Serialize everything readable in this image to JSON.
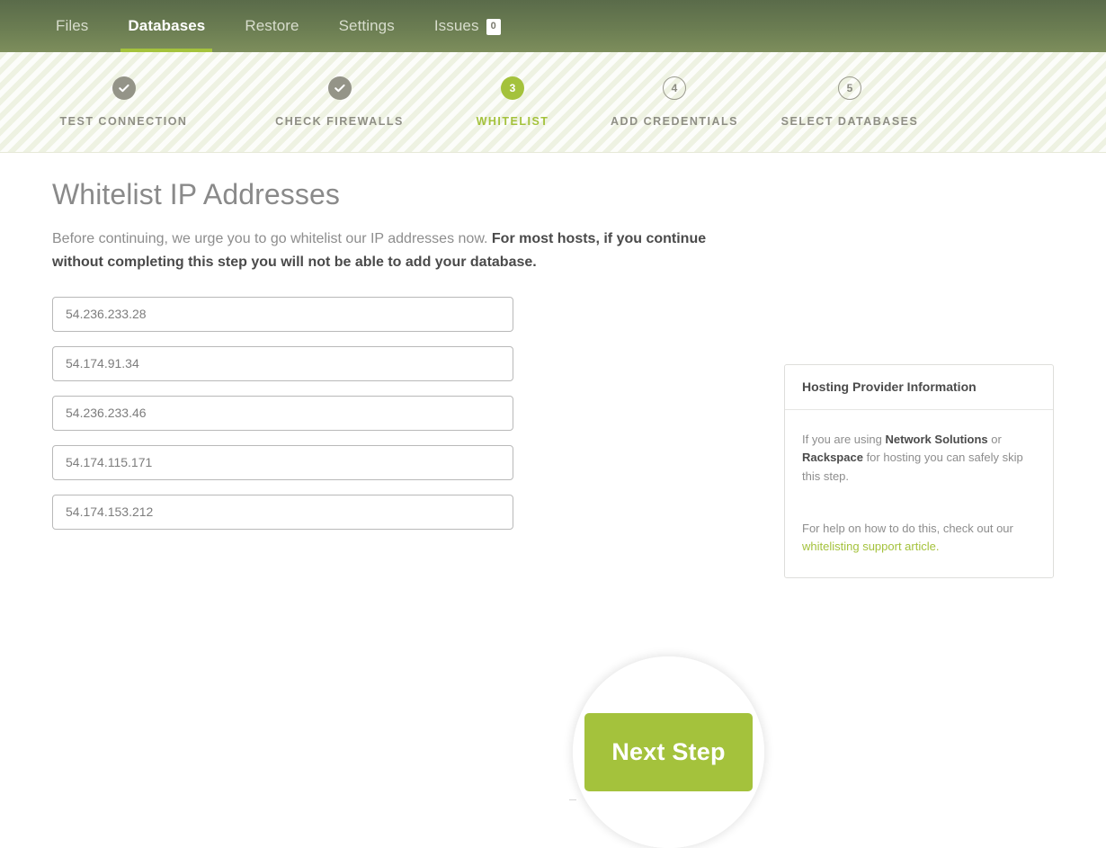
{
  "nav": {
    "items": [
      {
        "label": "Files",
        "active": false
      },
      {
        "label": "Databases",
        "active": true
      },
      {
        "label": "Restore",
        "active": false
      },
      {
        "label": "Settings",
        "active": false
      },
      {
        "label": "Issues",
        "active": false,
        "badge": "0"
      }
    ],
    "accent_color": "#a4c23c",
    "bar_color": "#6b7d52"
  },
  "stepper": {
    "steps": [
      {
        "number": "1",
        "label": "TEST CONNECTION",
        "state": "done",
        "icon": "check-icon"
      },
      {
        "number": "2",
        "label": "CHECK FIREWALLS",
        "state": "done",
        "icon": "check-icon"
      },
      {
        "number": "3",
        "label": "WHITELIST",
        "state": "active"
      },
      {
        "number": "4",
        "label": "ADD CREDENTIALS",
        "state": "pending"
      },
      {
        "number": "5",
        "label": "SELECT DATABASES",
        "state": "pending"
      }
    ],
    "done_color": "#949488",
    "active_color": "#a4c23c",
    "pending_color": "#9a9a8e"
  },
  "main": {
    "title": "Whitelist IP Addresses",
    "lede_normal": "Before continuing, we urge you to go whitelist our IP addresses now. ",
    "lede_bold": "For most hosts, if you continue without completing this step you will not be able to add your database.",
    "ip_addresses": [
      "54.236.233.28",
      "54.174.91.34",
      "54.236.233.46",
      "54.174.115.171",
      "54.174.153.212"
    ],
    "next_button_label": "Next Step"
  },
  "side_panel": {
    "title": "Hosting Provider Information",
    "para1_a": "If you are using ",
    "para1_b1": "Network Solutions",
    "para1_c": " or ",
    "para1_b2": "Rackspace",
    "para1_d": " for hosting you can safely skip this step.",
    "para2_a": "For help on how to do this, check out our ",
    "para2_link": "whitelisting support article.",
    "link_color": "#a4c23c"
  }
}
